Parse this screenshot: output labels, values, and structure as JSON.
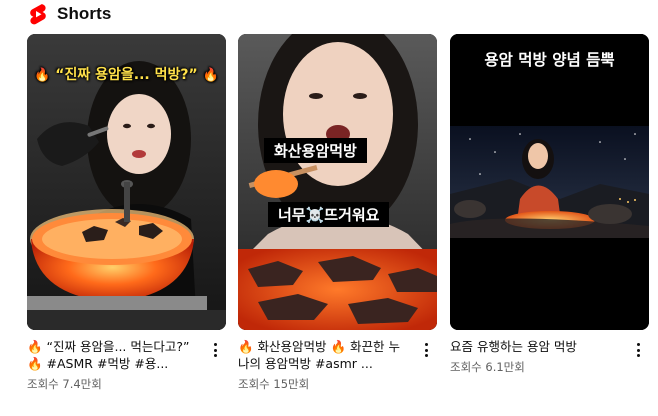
{
  "section": {
    "title": "Shorts",
    "icon": "youtube-shorts-icon",
    "brand_color": "#ff0000"
  },
  "videos": [
    {
      "overlay": "“진짜 용암을... 먹방?”",
      "title": "🔥 “진짜 용암을... 먹는다고?” 🔥 #ASMR #먹방 #용...",
      "views": "조회수 7.4만회"
    },
    {
      "overlay_1": "화산용암먹방",
      "overlay_2": "너무☠️뜨거워요",
      "title": "🔥 화산용암먹방 🔥 화끈한 누나의 용암먹방 #asmr ...",
      "views": "조회수 15만회"
    },
    {
      "overlay": "용암 먹방 양념 듬뿍",
      "title": "요즘 유행하는 용암 먹방",
      "views": "조회수 6.1만회"
    }
  ]
}
